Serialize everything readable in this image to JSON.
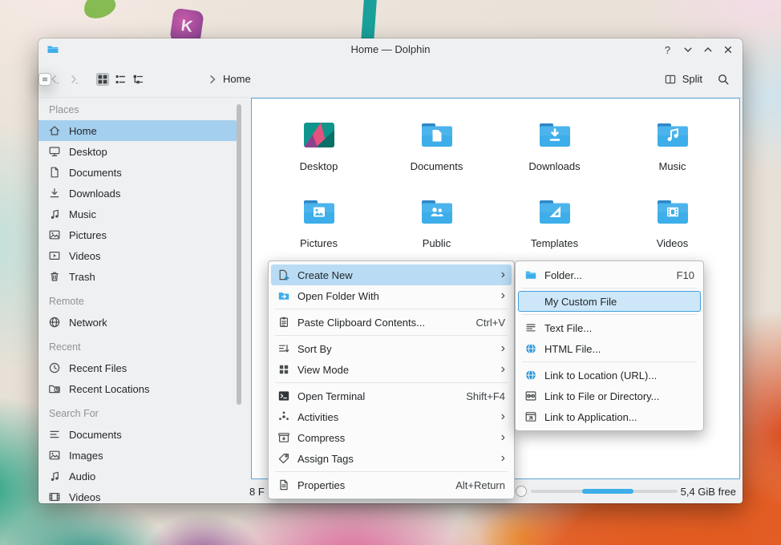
{
  "ui_colors": {
    "accent": "#3daee9",
    "selection": "#a5cfee",
    "window_bg": "#eff0f1"
  },
  "wallpaper": {
    "k_letter": "K"
  },
  "titlebar": {
    "title": "Home — Dolphin",
    "help_glyph": "?",
    "icons": [
      "app-folder-icon",
      "help-icon",
      "minimize-icon",
      "maximize-icon",
      "close-icon"
    ]
  },
  "toolbar": {
    "breadcrumb_current": "Home",
    "split_label": "Split",
    "icons": [
      "back-icon",
      "forward-icon",
      "icons-view-icon",
      "compact-view-icon",
      "details-view-icon",
      "breadcrumb-chevron-icon",
      "split-icon",
      "search-icon",
      "hamburger-menu-icon"
    ]
  },
  "sidebar": {
    "sections": [
      {
        "title": "Places",
        "items": [
          {
            "label": "Home",
            "icon": "home",
            "selected": true
          },
          {
            "label": "Desktop",
            "icon": "desktop"
          },
          {
            "label": "Documents",
            "icon": "document"
          },
          {
            "label": "Downloads",
            "icon": "download"
          },
          {
            "label": "Music",
            "icon": "music"
          },
          {
            "label": "Pictures",
            "icon": "picture"
          },
          {
            "label": "Videos",
            "icon": "video"
          },
          {
            "label": "Trash",
            "icon": "trash"
          }
        ]
      },
      {
        "title": "Remote",
        "items": [
          {
            "label": "Network",
            "icon": "globe"
          }
        ]
      },
      {
        "title": "Recent",
        "items": [
          {
            "label": "Recent Files",
            "icon": "clock"
          },
          {
            "label": "Recent Locations",
            "icon": "folder-clock"
          }
        ]
      },
      {
        "title": "Search For",
        "items": [
          {
            "label": "Documents",
            "icon": "lines"
          },
          {
            "label": "Images",
            "icon": "picture"
          },
          {
            "label": "Audio",
            "icon": "music"
          },
          {
            "label": "Videos",
            "icon": "film"
          }
        ]
      }
    ]
  },
  "folders": [
    {
      "name": "Desktop",
      "icon": "big-desktop"
    },
    {
      "name": "Documents",
      "icon": "big-documents"
    },
    {
      "name": "Downloads",
      "icon": "big-downloads"
    },
    {
      "name": "Music",
      "icon": "big-music"
    },
    {
      "name": "Pictures",
      "icon": "big-pictures"
    },
    {
      "name": "Public",
      "icon": "big-public"
    },
    {
      "name": "Templates",
      "icon": "big-templates"
    },
    {
      "name": "Videos",
      "icon": "big-videos"
    }
  ],
  "context_menu": {
    "items": [
      {
        "label": "Create New",
        "icon": "m-create",
        "submenu": true,
        "highlighted": true
      },
      {
        "label": "Open Folder With",
        "icon": "m-openwith",
        "submenu": true
      },
      {
        "label": "Paste Clipboard Contents...",
        "icon": "m-paste",
        "shortcut": "Ctrl+V"
      },
      {
        "label": "Sort By",
        "icon": "m-sort",
        "submenu": true
      },
      {
        "label": "View Mode",
        "icon": "m-viewmode",
        "submenu": true
      },
      {
        "label": "Open Terminal",
        "icon": "m-terminal",
        "shortcut": "Shift+F4"
      },
      {
        "label": "Activities",
        "icon": "m-activities",
        "submenu": true
      },
      {
        "label": "Compress",
        "icon": "m-compress",
        "submenu": true
      },
      {
        "label": "Assign Tags",
        "icon": "m-tags",
        "submenu": true
      },
      {
        "label": "Properties",
        "icon": "m-props",
        "shortcut": "Alt+Return"
      }
    ]
  },
  "submenu": {
    "items": [
      {
        "label": "Folder...",
        "icon": "m-folder",
        "shortcut": "F10"
      },
      {
        "label": "My Custom File",
        "highlighted": true
      },
      {
        "label": "Text File...",
        "icon": "m-textfile"
      },
      {
        "label": "HTML File...",
        "icon": "m-htmlfile"
      },
      {
        "label": "Link to Location (URL)...",
        "icon": "m-linkurl"
      },
      {
        "label": "Link to File or Directory...",
        "icon": "m-linkfile"
      },
      {
        "label": "Link to Application...",
        "icon": "m-linkapp"
      }
    ]
  },
  "statusbar": {
    "left_text": "8 F",
    "free_space": "5,4 GiB free"
  }
}
